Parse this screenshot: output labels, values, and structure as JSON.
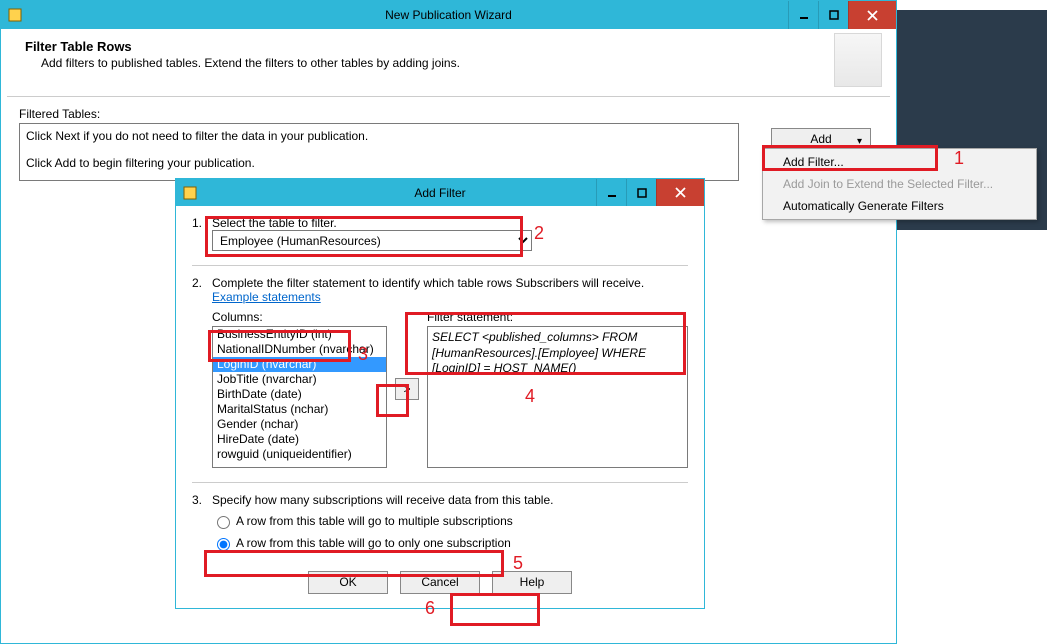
{
  "parent": {
    "title": "New Publication Wizard",
    "heading": "Filter Table Rows",
    "subheading": "Add filters to published tables. Extend the filters to other tables by adding joins.",
    "filtered_tables_label": "Filtered Tables:",
    "filtered_box_line1": "Click Next if you do not need to filter the data in your publication.",
    "filtered_box_line2": "Click Add to begin filtering your publication.",
    "add_button": "Add"
  },
  "add_menu": {
    "items": [
      {
        "label": "Add Filter...",
        "disabled": false
      },
      {
        "label": "Add Join to Extend the Selected Filter...",
        "disabled": true
      },
      {
        "label": "Automatically Generate Filters",
        "disabled": false
      }
    ]
  },
  "dialog": {
    "title": "Add Filter",
    "step1_num": "1.",
    "step1_text": "Select the table to filter.",
    "table_selected": "Employee (HumanResources)",
    "step2_num": "2.",
    "step2_text_a": "Complete the filter statement to identify which table rows Subscribers will receive. ",
    "step2_link": "Example statements",
    "columns_label": "Columns:",
    "columns": [
      "BusinessEntityID (int)",
      "NationalIDNumber (nvarchar)",
      "LoginID (nvarchar)",
      "JobTitle (nvarchar)",
      "BirthDate (date)",
      "MaritalStatus (nchar)",
      "Gender (nchar)",
      "HireDate (date)",
      "rowguid (uniqueidentifier)"
    ],
    "columns_selected_index": 2,
    "arrow_label": ">",
    "filter_label": "Filter statement:",
    "filter_stmt": "SELECT <published_columns> FROM [HumanResources].[Employee] WHERE [LoginID] = HOST_NAME()",
    "step3_num": "3.",
    "step3_text": "Specify how many subscriptions will receive data from this table.",
    "radio1": "A row from this table will go to multiple subscriptions",
    "radio2": "A row from this table will go to only one subscription",
    "ok": "OK",
    "cancel": "Cancel",
    "help": "Help"
  },
  "annotations": {
    "n1": "1",
    "n2": "2",
    "n3": "3",
    "n4": "4",
    "n5": "5",
    "n6": "6"
  }
}
